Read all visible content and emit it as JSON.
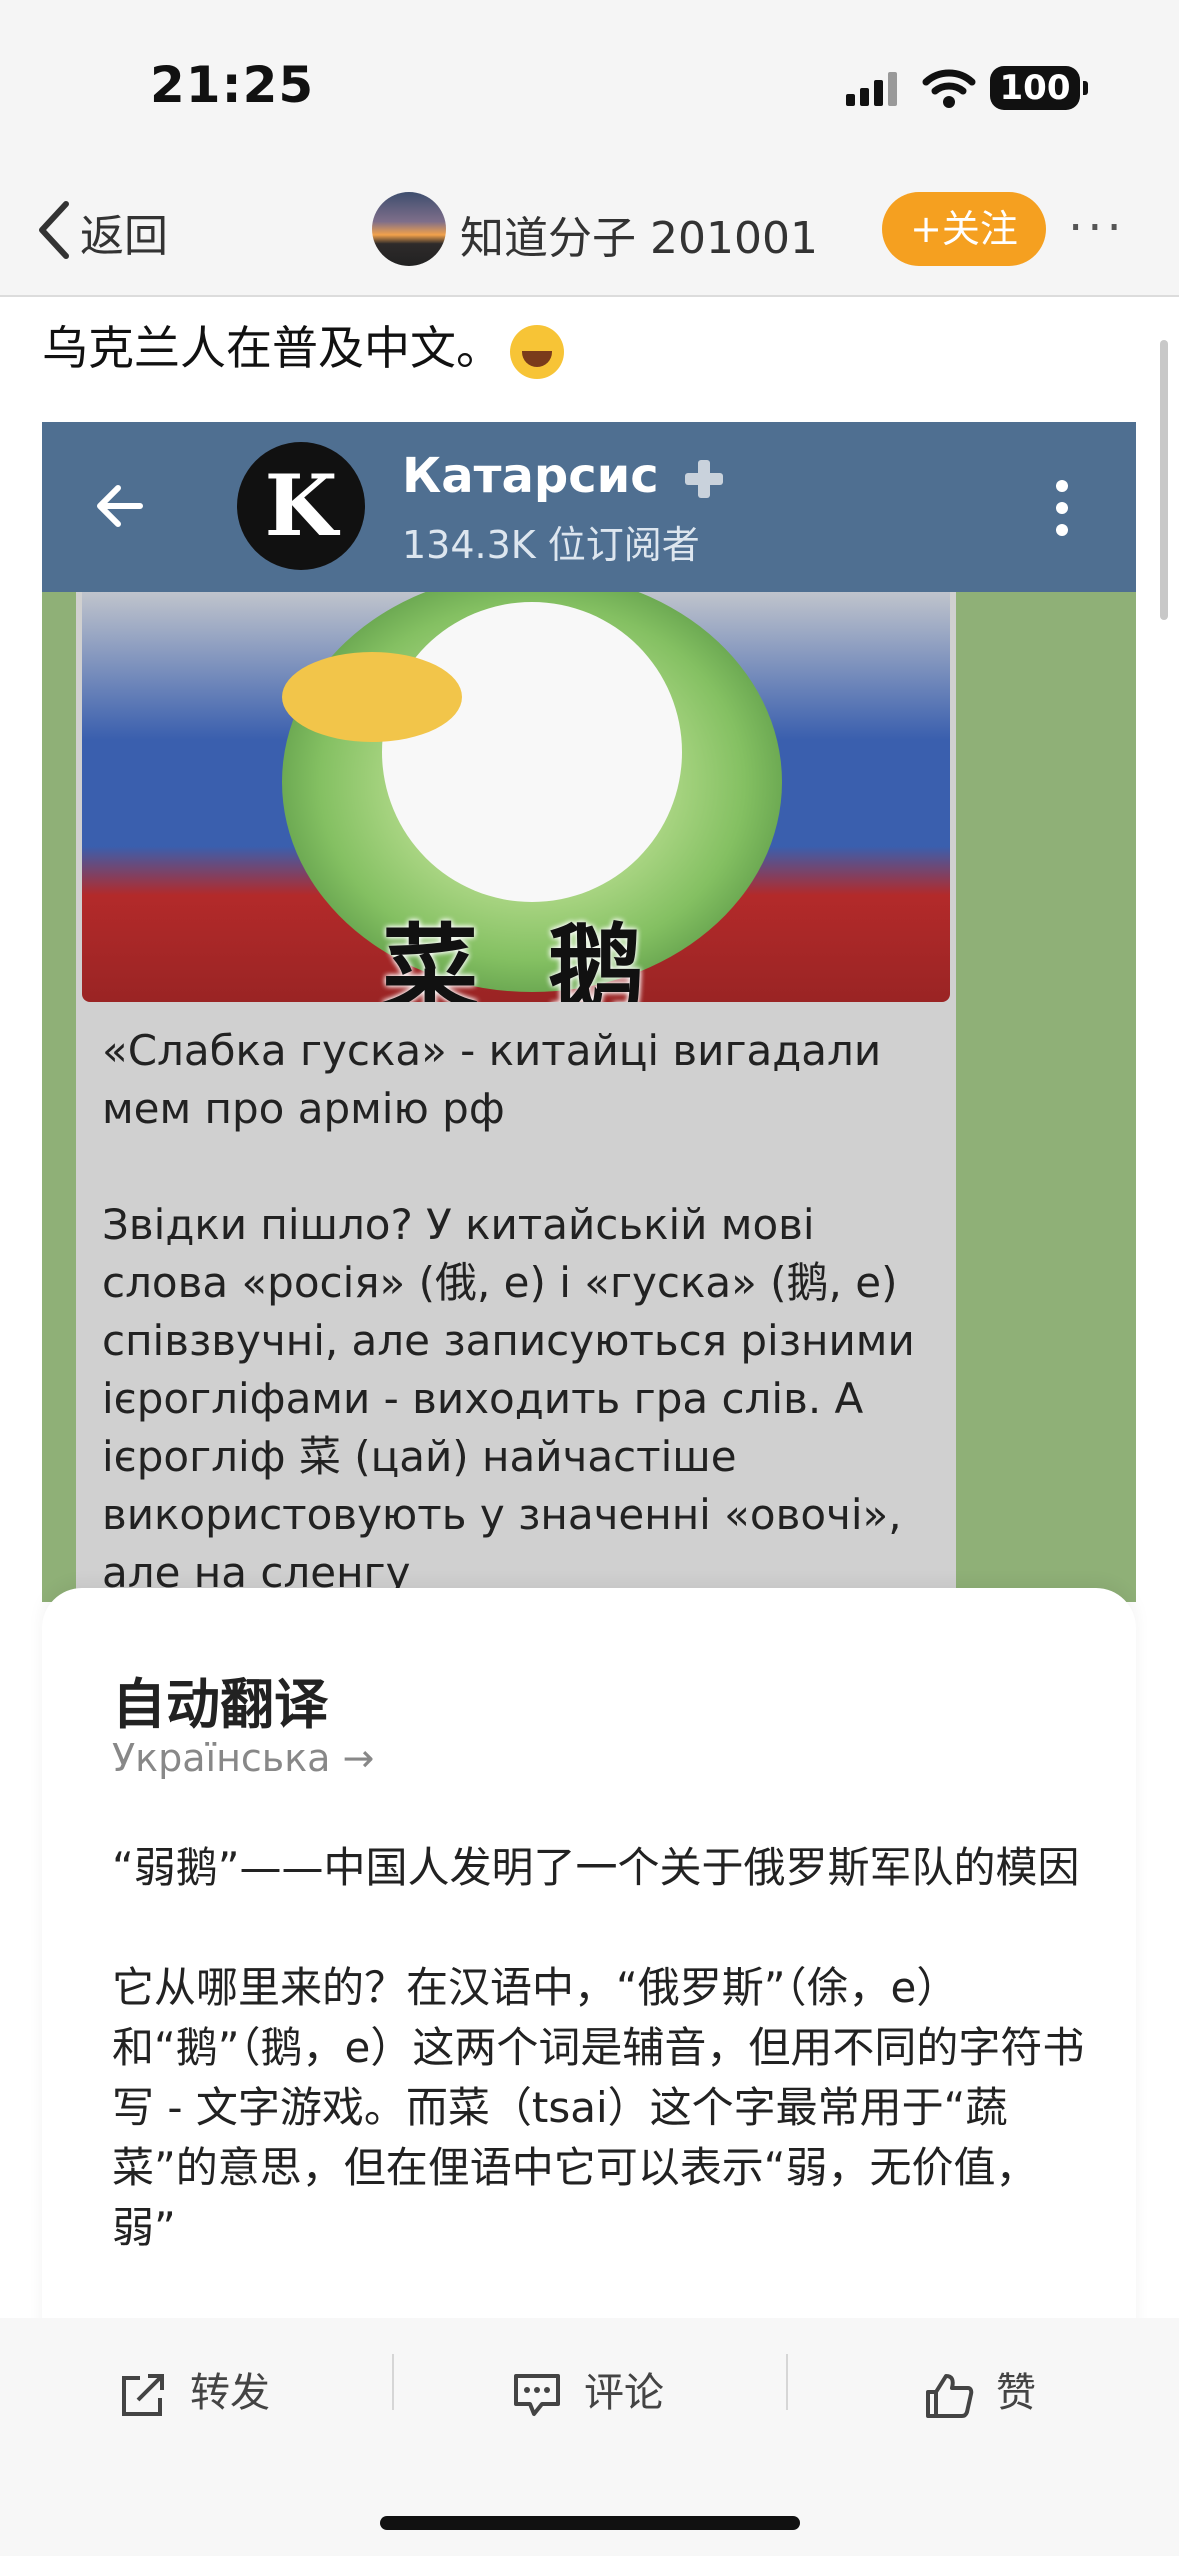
{
  "status_bar": {
    "time": "21:25",
    "battery": "100"
  },
  "nav": {
    "back_label": "返回",
    "title": "知道分子 201001",
    "follow_label": "+关注",
    "more_label": "···"
  },
  "post": {
    "text": "乌克兰人在普及中文。"
  },
  "embedded_screenshot": {
    "channel_logo": "K",
    "channel_name": "Катарсис",
    "subscribers": "134.3K 位订阅者",
    "image_caption": "菜鹅",
    "message": "«Слабка гуска» - китайці вигадали мем про армію рф\n\nЗвідки пішло? У китайській мові слова «росія» (俄, е) і «гуска» (鹅, е) співзвучні, але записуються різними ієрогліфами - виходить гра слів. А ієрогліф 菜 (цай) найчастіше використовують у значенні «овочі», але на сленгу"
  },
  "translation": {
    "title": "自动翻译",
    "source_language": "Українська →",
    "text": "“弱鹅”——中国人发明了一个关于俄罗斯军队的模因\n\n它从哪里来的？在汉语中，“俄罗斯”（俆，e）和“鹅”（鹅，e）这两个词是辅音，但用不同的字符书写 - 文字游戏。而菜（tsai）这个字最常用于“蔬菜”的意思，但在俚语中它可以表示“弱，无价值，弱”"
  },
  "bottom_bar": {
    "repost_label": "转发",
    "comment_label": "评论",
    "like_label": "赞"
  },
  "colors": {
    "follow": "#f5a020",
    "telegram_header": "#4f6f91",
    "telegram_background": "#8fb077"
  }
}
